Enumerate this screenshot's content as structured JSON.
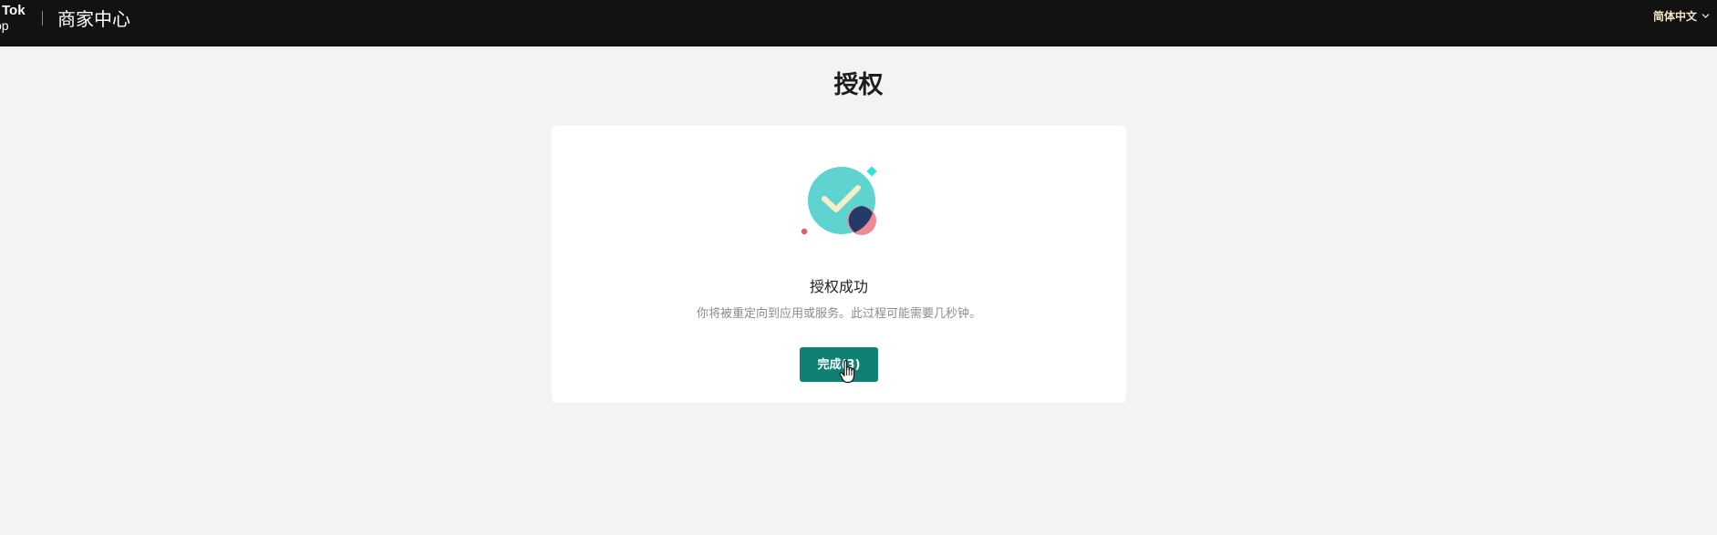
{
  "header": {
    "logo_line1": "Tok",
    "logo_line2": "op",
    "brand_title": "商家中心",
    "language": "简体中文"
  },
  "main": {
    "page_title": "授权",
    "status_title": "授权成功",
    "status_description": "你将被重定向到应用或服务。此过程可能需要几秒钟。",
    "done_button_label": "完成(3)"
  },
  "icons": {
    "logo": "tiktok-shop-logo",
    "language_chevron": "chevron-down-icon",
    "success": "success-check-illustration",
    "pointer": "hand-pointer-icon"
  },
  "colors": {
    "header_bg": "#121212",
    "page_bg": "#f3f3f3",
    "primary_button": "#0e8074",
    "check_circle": "#5fd3d0",
    "check_mark": "#f7efc7",
    "accent_navy": "#243b68",
    "accent_pink": "#ee8c95"
  }
}
